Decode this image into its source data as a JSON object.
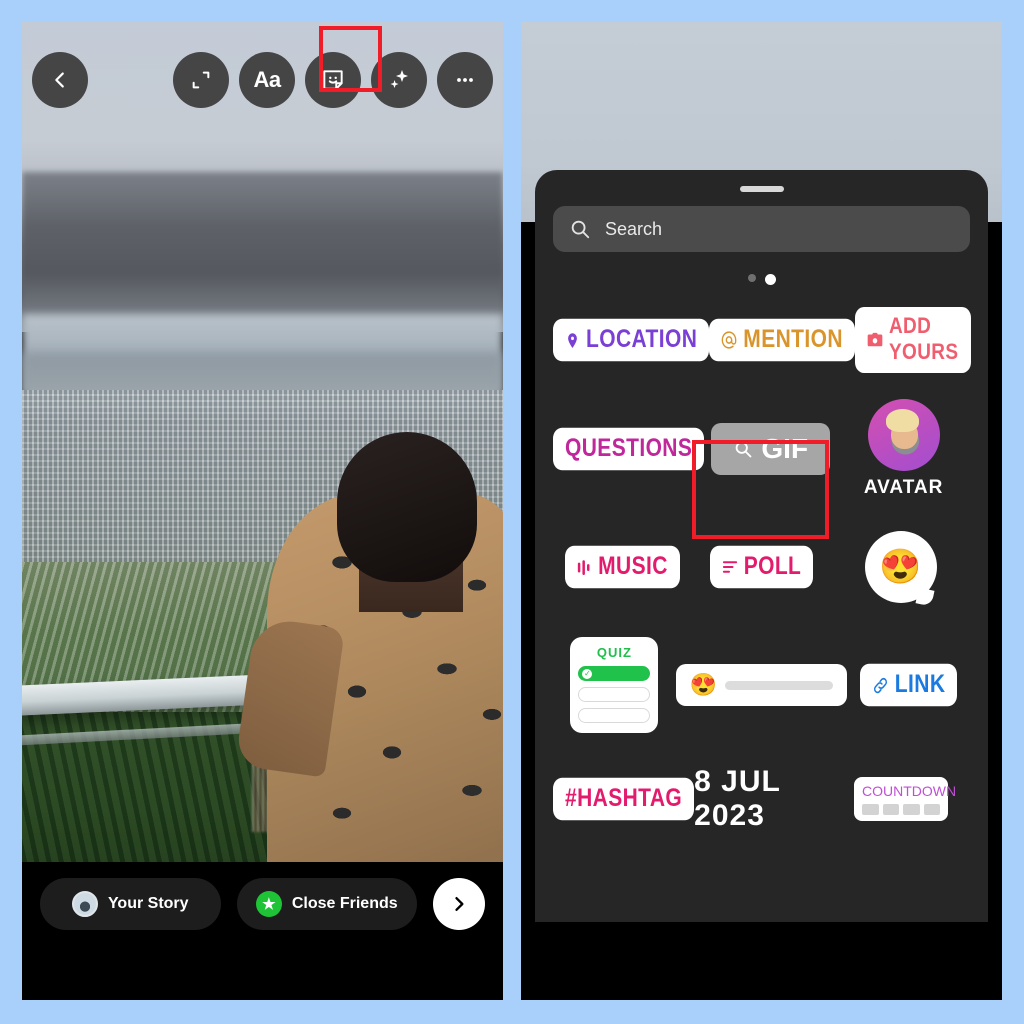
{
  "background_color": "#a9d0fb",
  "left_panel": {
    "name": "instagram-story-composer",
    "toolbar": {
      "back_label": "‹",
      "items": [
        {
          "name": "resize-aspect",
          "label": ""
        },
        {
          "name": "text-tool",
          "label": "Aa"
        },
        {
          "name": "sticker-tool",
          "label": ""
        },
        {
          "name": "effects-tool",
          "label": ""
        },
        {
          "name": "more-options",
          "label": "•••"
        }
      ]
    },
    "photo_description": "Man in patterned shirt looking out over a hazy city valley from a hilltop railing",
    "bottom_bar": {
      "your_story_label": "Your Story",
      "close_friends_label": "Close Friends",
      "next_label": "›"
    },
    "highlight": {
      "target": "sticker-tool",
      "color": "#f01c27"
    }
  },
  "right_panel": {
    "name": "instagram-sticker-tray",
    "search": {
      "placeholder": "Search",
      "value": ""
    },
    "page_dots": {
      "count": 2,
      "active_index": 1
    },
    "stickers": {
      "row1": [
        {
          "name": "location-sticker",
          "label": "LOCATION",
          "icon": "pin-icon",
          "color": "#7a3fd4"
        },
        {
          "name": "mention-sticker",
          "label": "MENTION",
          "icon": "at-icon",
          "color": "#d9952c"
        },
        {
          "name": "add-yours-sticker",
          "label": "ADD YOURS",
          "icon": "camera-icon",
          "color": "#ef5d6e"
        }
      ],
      "row2": [
        {
          "name": "questions-sticker",
          "label": "QUESTIONS",
          "color": "#c0279b"
        },
        {
          "name": "gif-sticker",
          "label": "GIF",
          "icon": "search-icon",
          "color": "#ffffff"
        },
        {
          "name": "avatar-sticker",
          "label": "AVATAR",
          "color": "#ffffff"
        }
      ],
      "row3": [
        {
          "name": "music-sticker",
          "label": "MUSIC",
          "icon": "bars-icon",
          "color": "#e31b6d"
        },
        {
          "name": "poll-sticker",
          "label": "POLL",
          "icon": "lines-icon",
          "color": "#e31b6d"
        },
        {
          "name": "emoji-reaction-sticker",
          "label": "😍"
        }
      ],
      "row4": [
        {
          "name": "quiz-sticker",
          "label": "QUIZ",
          "color": "#1fbf4a"
        },
        {
          "name": "emoji-slider-sticker",
          "label": "😍"
        },
        {
          "name": "link-sticker",
          "label": "LINK",
          "icon": "chain-icon",
          "color": "#1a7ae0"
        }
      ],
      "row5": [
        {
          "name": "hashtag-sticker",
          "label": "#HASHTAG",
          "color": "#e31b6d"
        },
        {
          "name": "date-sticker",
          "label": "8 JUL 2023",
          "color": "#ffffff"
        },
        {
          "name": "countdown-sticker",
          "label": "COUNTDOWN",
          "color": "#c04fd6"
        }
      ]
    },
    "highlight": {
      "target": "gif-sticker",
      "color": "#f01c27"
    }
  }
}
